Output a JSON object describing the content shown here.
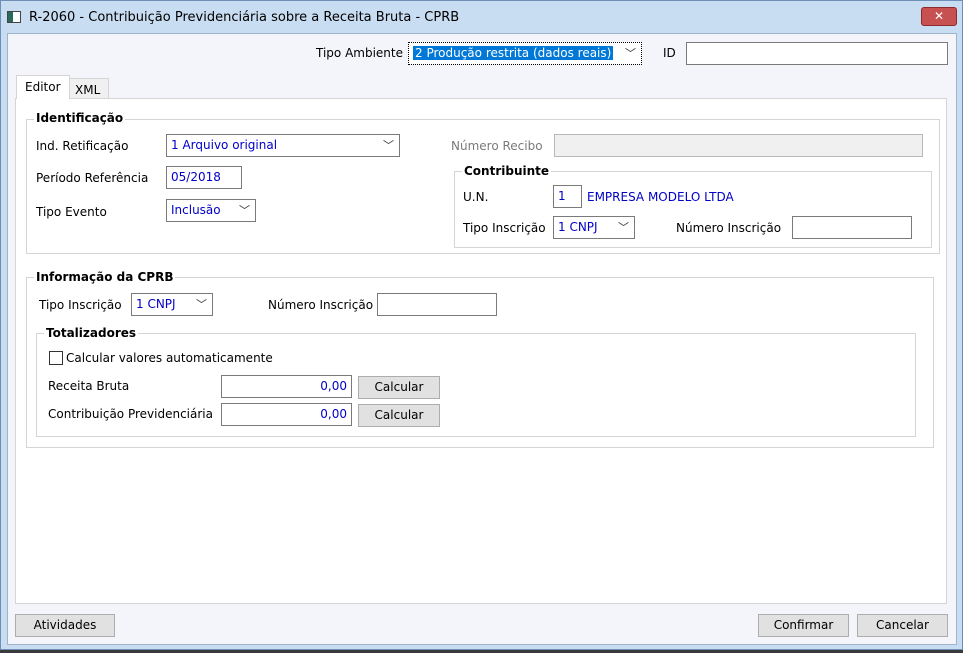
{
  "window": {
    "title": "R-2060 - Contribuição Previdenciária sobre a Receita Bruta - CPRB",
    "close": "✕"
  },
  "header": {
    "tipo_ambiente_label": "Tipo Ambiente",
    "tipo_ambiente_value": "2 Produção restrita (dados reais)",
    "id_label": "ID",
    "id_value": ""
  },
  "tabs": [
    {
      "label": "Editor"
    },
    {
      "label": "XML"
    }
  ],
  "identificacao": {
    "title": "Identificação",
    "ind_retificacao_label": "Ind. Retificação",
    "ind_retificacao_value": "1 Arquivo original",
    "periodo_label": "Período Referência",
    "periodo_value": "05/2018",
    "tipo_evento_label": "Tipo Evento",
    "tipo_evento_value": "Inclusão",
    "numero_recibo_label": "Número Recibo",
    "numero_recibo_value": ""
  },
  "contribuinte": {
    "title": "Contribuinte",
    "un_label": "U.N.",
    "un_value": "1",
    "empresa": "EMPRESA MODELO LTDA",
    "tipo_inscricao_label": "Tipo Inscrição",
    "tipo_inscricao_value": "1 CNPJ",
    "numero_inscricao_label": "Número Inscrição",
    "numero_inscricao_value": ""
  },
  "cprb": {
    "title": "Informação da CPRB",
    "tipo_inscricao_label": "Tipo Inscrição",
    "tipo_inscricao_value": "1 CNPJ",
    "numero_inscricao_label": "Número Inscrição",
    "numero_inscricao_value": ""
  },
  "totalizadores": {
    "title": "Totalizadores",
    "auto_label": "Calcular valores automaticamente",
    "auto_checked": false,
    "receita_label": "Receita Bruta",
    "receita_value": "0,00",
    "contrib_label": "Contribuição Previdenciária",
    "contrib_value": "0,00",
    "calcular": "Calcular"
  },
  "footer": {
    "atividades": "Atividades",
    "confirmar": "Confirmar",
    "cancelar": "Cancelar"
  }
}
